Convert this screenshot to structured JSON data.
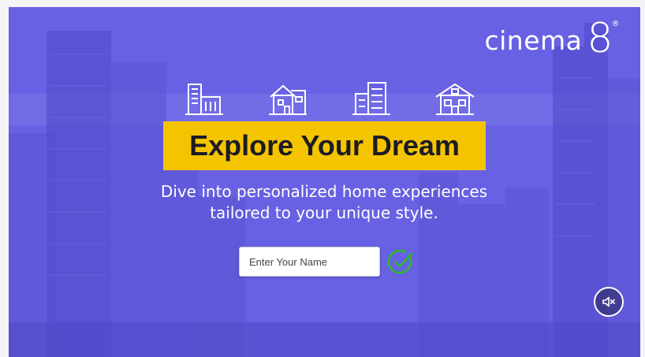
{
  "brand": {
    "name": "cinema",
    "mark": "8",
    "registered": "®"
  },
  "hero": {
    "headline": "Explore Your Dream",
    "subtitle_line1": "Dive into personalized home experiences",
    "subtitle_line2": "tailored to your unique style."
  },
  "form": {
    "name_placeholder": "Enter Your Name"
  },
  "icons": [
    "office-building-icon",
    "house-icon",
    "apartment-block-icon",
    "villa-icon",
    "check-circle-icon",
    "volume-mute-icon"
  ],
  "colors": {
    "overlay": "#6a63de",
    "headline_bg": "#f5c400",
    "check": "#2eb82e"
  }
}
